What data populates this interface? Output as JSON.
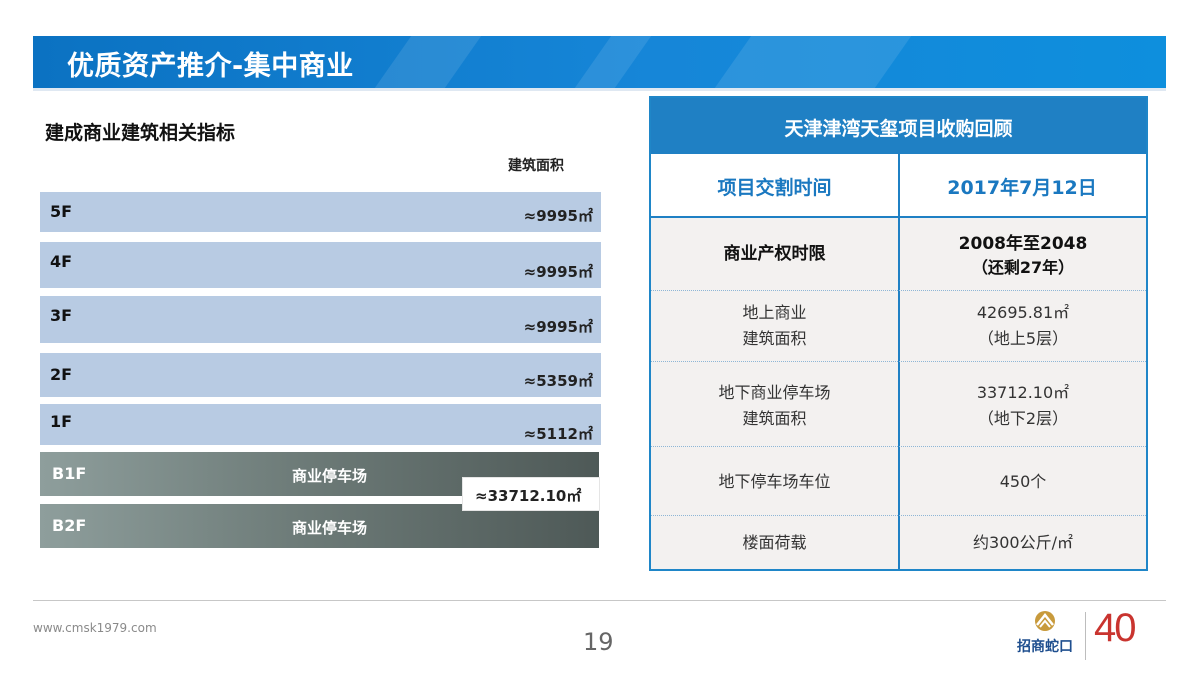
{
  "header": {
    "title": "优质资产推介-集中商业"
  },
  "left": {
    "title": "建成商业建筑相关指标",
    "area_header": "建筑面积",
    "floors": [
      {
        "label": "5F",
        "area": "≈9995㎡"
      },
      {
        "label": "4F",
        "area": "≈9995㎡"
      },
      {
        "label": "3F",
        "area": "≈9995㎡"
      },
      {
        "label": "2F",
        "area": "≈5359㎡"
      },
      {
        "label": "1F",
        "area": "≈5112㎡"
      }
    ],
    "basements": [
      {
        "label": "B1F",
        "use": "商业停车场"
      },
      {
        "label": "B2F",
        "use": "商业停车场"
      }
    ],
    "basement_area": "≈33712.10㎡"
  },
  "table": {
    "title": "天津津湾天玺项目收购回顾",
    "handover_label": "项目交割时间",
    "handover_value": "2017年7月12日",
    "rows": [
      {
        "label": "商业产权时限",
        "value_line1": "2008年至2048",
        "value_line2": "（还剩27年）"
      },
      {
        "label_line1": "地上商业",
        "label_line2": "建筑面积",
        "value_line1": "42695.81㎡",
        "value_line2": "（地上5层）"
      },
      {
        "label_line1": "地下商业停车场",
        "label_line2": "建筑面积",
        "value_line1": "33712.10㎡",
        "value_line2": "（地下2层）"
      },
      {
        "label": "地下停车场车位",
        "value": "450个"
      },
      {
        "label": "楼面荷载",
        "value": "约300公斤/㎡"
      }
    ]
  },
  "footer": {
    "website": "www.cmsk1979.com",
    "page": "19",
    "logo_text": "招商蛇口",
    "anniversary": "40"
  },
  "colors": {
    "banner": "#1686d8",
    "floor_fill": "#b8cbe3",
    "basement_fill": "#6e7c79",
    "table_border": "#1f80c4",
    "table_head_text": "#1a78c0",
    "logo_gold": "#c89a3c",
    "anniversary_red": "#c9342f"
  }
}
